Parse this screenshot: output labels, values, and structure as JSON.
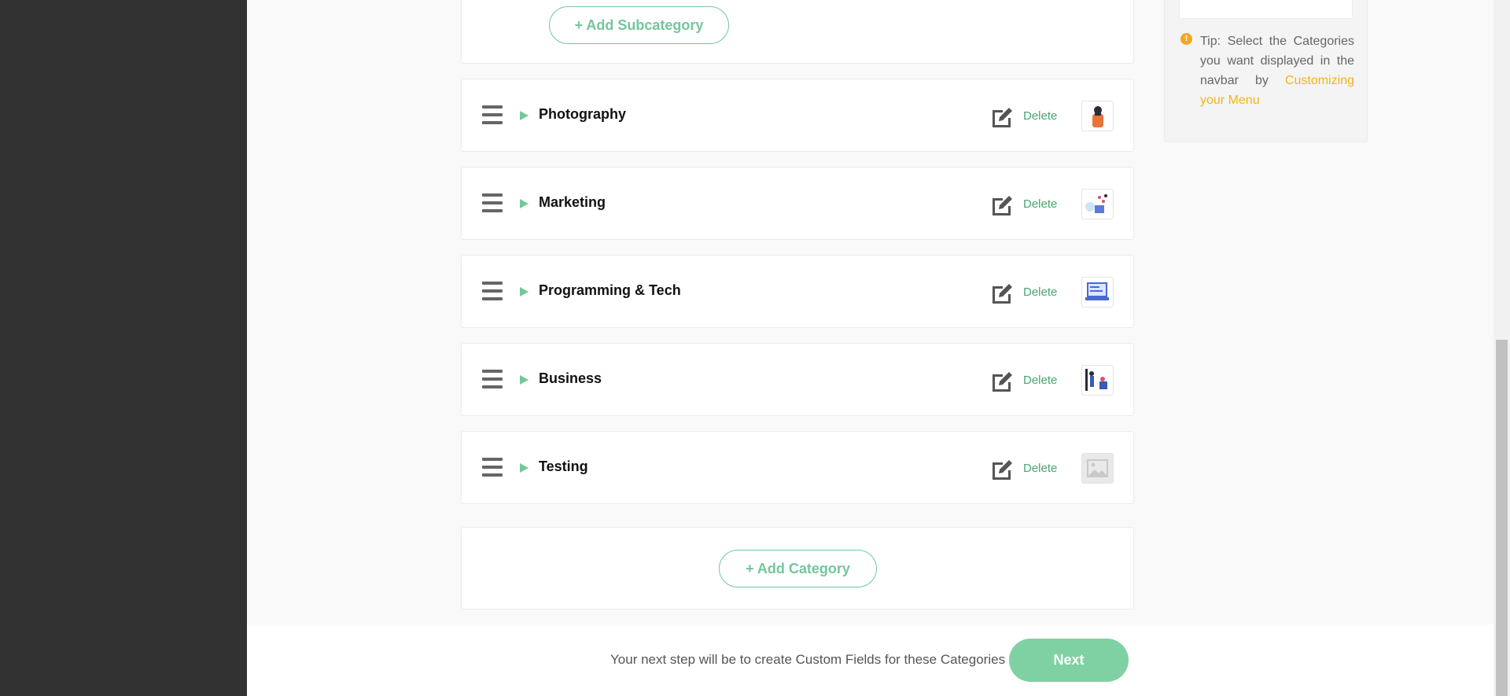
{
  "subcategory": {
    "add_label": "+ Add Subcategory"
  },
  "categories": [
    {
      "title": "Photography",
      "delete_label": "Delete",
      "thumbnail_icon": "photographer-illustration-icon"
    },
    {
      "title": "Marketing",
      "delete_label": "Delete",
      "thumbnail_icon": "marketing-illustration-icon"
    },
    {
      "title": "Programming & Tech",
      "delete_label": "Delete",
      "thumbnail_icon": "laptop-illustration-icon"
    },
    {
      "title": "Business",
      "delete_label": "Delete",
      "thumbnail_icon": "business-illustration-icon"
    },
    {
      "title": "Testing",
      "delete_label": "Delete",
      "thumbnail_icon": "image-placeholder-icon"
    }
  ],
  "add_category_label": "+ Add Category",
  "tip": {
    "text": "Tip: Select the Categories you want displayed in the navbar by",
    "link": "Customizing your Menu"
  },
  "footer": {
    "text": "Your next step will be to create Custom Fields for these Categories",
    "next_label": "Next"
  },
  "colors": {
    "accent": "#74c69d",
    "next_button": "#7fd1a3",
    "delete_link": "#4aa56f",
    "tip_link": "#f5b31a",
    "sidebar_dark": "#323232"
  }
}
